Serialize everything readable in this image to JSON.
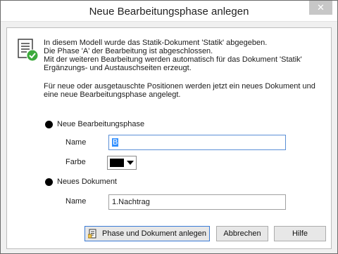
{
  "window": {
    "title": "Neue Bearbeitungsphase anlegen",
    "close_glyph": "✕"
  },
  "info": {
    "line1": "In diesem Modell wurde das Statik-Dokument 'Statik' abgegeben.",
    "line2": "Die Phase 'A' der Bearbeitung ist abgeschlossen.",
    "line3": "Mit der weiteren Bearbeitung werden automatisch für das Dokument 'Statik'",
    "line4": "Ergänzungs- und Austauschseiten erzeugt.",
    "line5": "Für neue oder ausgetauschte Positionen werden jetzt ein neues Dokument und",
    "line6": "eine neue Bearbeitungsphase angelegt."
  },
  "phase": {
    "option_label": "Neue Bearbeitungsphase",
    "name_label": "Name",
    "name_value": "B",
    "color_label": "Farbe",
    "color_value": "#000000"
  },
  "document": {
    "option_label": "Neues Dokument",
    "name_label": "Name",
    "name_value": "1.Nachtrag"
  },
  "buttons": {
    "create": "Phase und Dokument anlegen",
    "cancel": "Abbrechen",
    "help": "Hilfe"
  },
  "icons": {
    "doc": "document-check-icon",
    "create": "document-add-icon",
    "close": "close-icon",
    "dropdown": "chevron-down-icon"
  },
  "colors": {
    "accent": "#3390ff",
    "check": "#3caa3c"
  }
}
